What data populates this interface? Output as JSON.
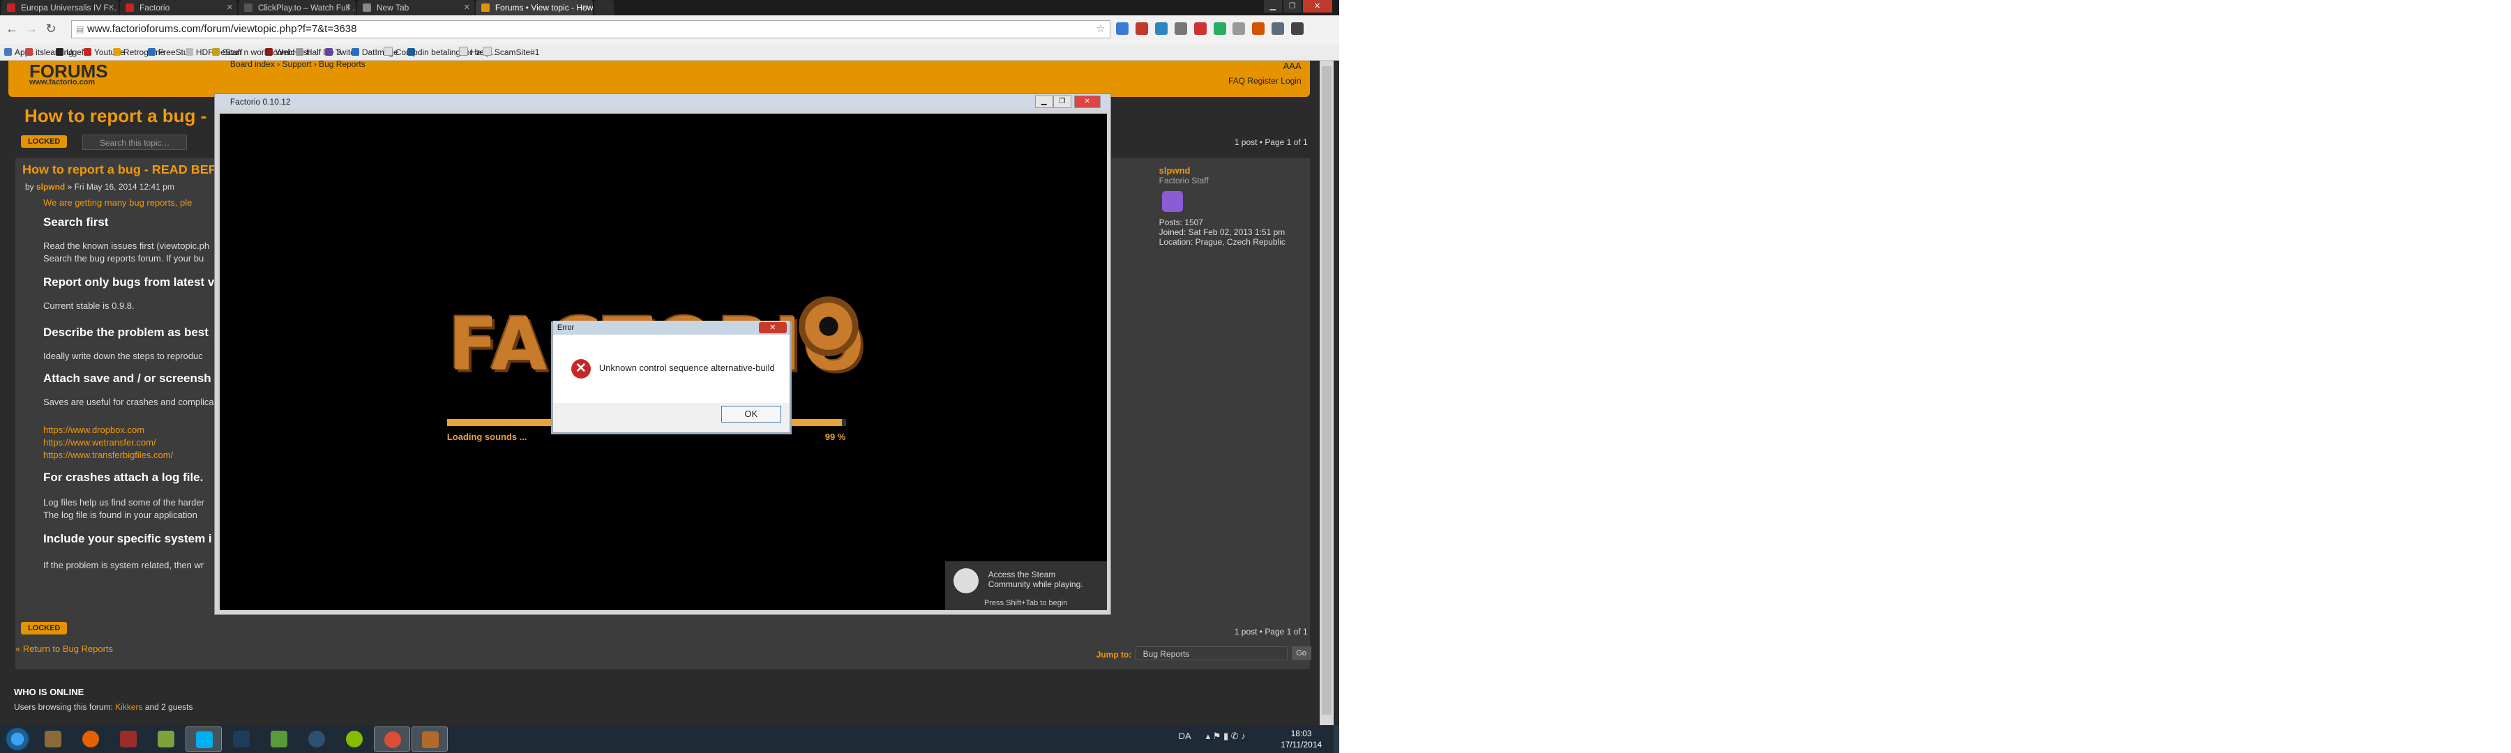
{
  "browser": {
    "tabs": [
      {
        "label": "Europa Universalis IV F…",
        "favicon_color": "#cc2222"
      },
      {
        "label": "Factorio",
        "favicon_color": "#cc2222"
      },
      {
        "label": "ClickPlay.to – Watch Full …",
        "favicon_color": "#555555"
      },
      {
        "label": "New Tab",
        "favicon_color": "#888888"
      },
      {
        "label": "Forums • View topic - How…",
        "favicon_color": "#e59400"
      }
    ],
    "active_tab_index": 4,
    "url": "www.factorioforums.com/forum/viewtopic.php?f=7&t=3638",
    "bookmarks": [
      "Apps",
      "itsleaming",
      "UgeNr.",
      "Youtube",
      "Retrogame",
      "FreeStuff",
      "HDFreeStuff",
      "Scan n world comic",
      "WebHost",
      "Half life 3",
      "Twitch",
      "DatImage",
      "Comp",
      "din betaling for bos…",
      "Hælp",
      "ScamSite#1"
    ]
  },
  "forum": {
    "logo": "FORUMS",
    "logo_sub": "www.factorio.com",
    "breadcrumb": "Board index  ›  Support  ›  Bug Reports",
    "header_links": "FAQ   Register   Login",
    "font_size_icons": "AAA",
    "topic_title": "How to report a bug - ",
    "locked_label": "LOCKED",
    "search_placeholder": "Search this topic…",
    "pagination": "1 post • Page 1 of 1",
    "post": {
      "title": "How to report a bug - READ BEFO",
      "byline_prefix": "by ",
      "author": "slpwnd",
      "date": " » Fri May 16, 2014 12:41 pm",
      "lines": [
        {
          "text": "We are getting many bug reports, ple",
          "style": "o"
        },
        {
          "text": "Search first",
          "style": "h"
        },
        {
          "text": "Read the known issues first (viewtopic.ph",
          "style": ""
        },
        {
          "text": "Search the bug reports forum. If your bu",
          "style": ""
        },
        {
          "text": "Report only bugs from latest v",
          "style": "h"
        },
        {
          "text": "Current stable is 0.9.8.",
          "style": ""
        },
        {
          "text": "Describe the problem as best",
          "style": "h"
        },
        {
          "text": "Ideally write down the steps to reproduc",
          "style": ""
        },
        {
          "text": "Attach save and / or screensh",
          "style": "h"
        },
        {
          "text": "Saves are useful for crashes and complica",
          "style": ""
        },
        {
          "text": "https://www.dropbox.com",
          "style": "o"
        },
        {
          "text": "https://www.wetransfer.com/",
          "style": "o"
        },
        {
          "text": "https://www.transferbigfiles.com/",
          "style": "o"
        },
        {
          "text": "For crashes attach a log file.",
          "style": "h"
        },
        {
          "text": "Log files help us find some of the harder",
          "style": ""
        },
        {
          "text": "The log file is found in your application",
          "style": ""
        },
        {
          "text": "Include your specific system i",
          "style": "h"
        },
        {
          "text": "If the problem is system related, then wr",
          "style": ""
        }
      ]
    },
    "profile": {
      "name": "slpwnd",
      "rank": "Factorio Staff",
      "posts": "Posts: 1507",
      "joined": "Joined: Sat Feb 02, 2013 1:51 pm",
      "location": "Location: Prague, Czech Republic"
    },
    "back_link": "« Return to Bug Reports",
    "jump_to_label": "Jump to:",
    "jump_to_value": "Bug Reports",
    "go_label": "Go",
    "whois_title": "WHO IS ONLINE",
    "whois_prefix": "Users browsing this forum: ",
    "whois_user": "Kikkers",
    "whois_suffix": " and 2 guests"
  },
  "game": {
    "window_title": "Factorio 0.10.12",
    "logo_text": "FACTORIO",
    "loading_text": "Loading sounds ...",
    "loading_percent": "99 %",
    "progress": 0.99,
    "steam_message": "Access the Steam Community while playing.",
    "steam_hint": "Press Shift+Tab to begin"
  },
  "dialog": {
    "title": "Error",
    "message": "Unknown control sequence alternative-build",
    "ok_label": "OK"
  },
  "taskbar": {
    "apps": [
      {
        "name": "tools-app",
        "color": "#8a6a3a"
      },
      {
        "name": "firefox",
        "color": "#e66000"
      },
      {
        "name": "archive-app",
        "color": "#9b2c2c"
      },
      {
        "name": "notes-app",
        "color": "#7da23a"
      },
      {
        "name": "skype",
        "color": "#00aff0"
      },
      {
        "name": "photoshop",
        "color": "#1e3c5a"
      },
      {
        "name": "notepad-app",
        "color": "#5a9a3a"
      },
      {
        "name": "steam",
        "color": "#2f4f6f"
      },
      {
        "name": "spotify",
        "color": "#84bd00"
      },
      {
        "name": "chrome",
        "color": "#dd4b39"
      },
      {
        "name": "factorio",
        "color": "#b06a2a"
      }
    ],
    "language": "DA",
    "time": "18:03",
    "date": "17/11/2014"
  }
}
